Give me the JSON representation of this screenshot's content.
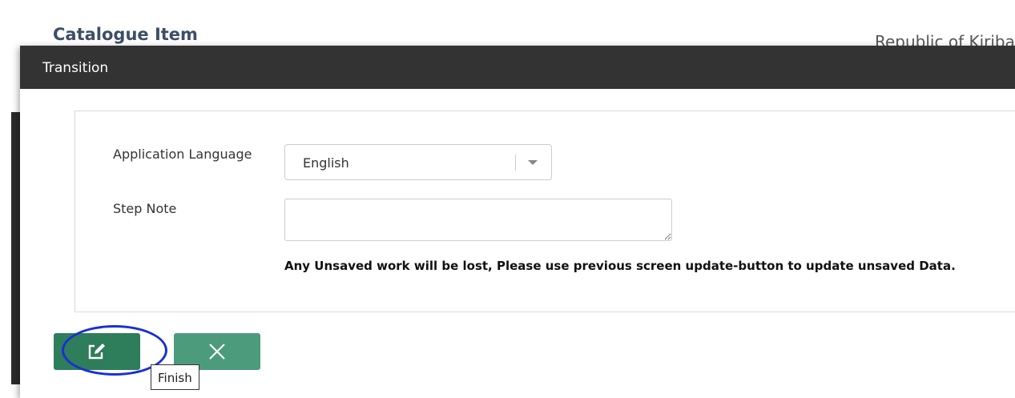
{
  "background": {
    "page_title": "Catalogue Item",
    "country_label": "Republic of Kiribati"
  },
  "modal": {
    "title": "Transition",
    "fields": {
      "language_label": "Application Language",
      "language_value": "English",
      "step_note_label": "Step Note",
      "step_note_value": ""
    },
    "warning": "Any Unsaved work will be lost, Please use previous screen update-button to update unsaved Data.",
    "buttons": {
      "finish_tooltip": "Finish"
    }
  },
  "colors": {
    "header": "#333333",
    "button": "#3f9371",
    "highlight": "#1a2fd6"
  },
  "icons": {
    "finish": "edit-icon",
    "cancel": "close-icon",
    "dropdown": "caret-down-icon"
  }
}
